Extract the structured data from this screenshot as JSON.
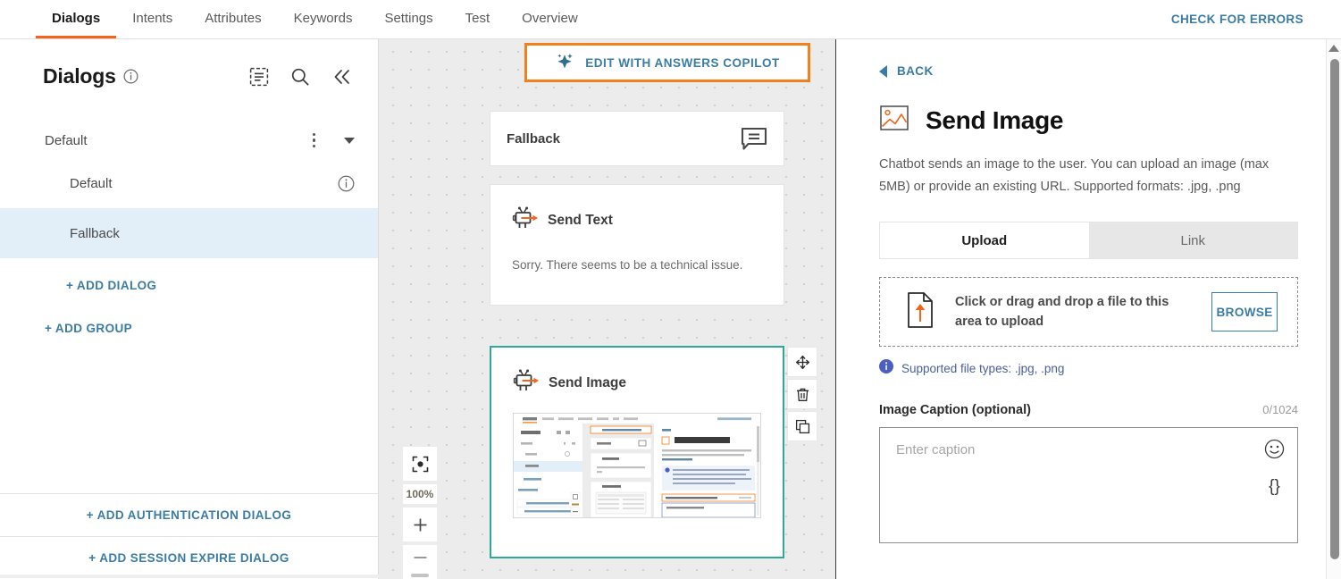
{
  "topbar": {
    "tabs": [
      {
        "label": "Dialogs",
        "active": true
      },
      {
        "label": "Intents",
        "active": false
      },
      {
        "label": "Attributes",
        "active": false
      },
      {
        "label": "Keywords",
        "active": false
      },
      {
        "label": "Settings",
        "active": false
      },
      {
        "label": "Test",
        "active": false
      },
      {
        "label": "Overview",
        "active": false
      }
    ],
    "check_errors": "CHECK FOR ERRORS"
  },
  "sidebar": {
    "title": "Dialogs",
    "group": {
      "name": "Default"
    },
    "items": [
      {
        "label": "Default",
        "selected": false,
        "has_info": true
      },
      {
        "label": "Fallback",
        "selected": true,
        "has_info": false
      }
    ],
    "add_dialog": "+ ADD DIALOG",
    "add_group": "+ ADD GROUP",
    "add_auth_dialog": "+ ADD AUTHENTICATION DIALOG",
    "add_session_expire_dialog": "+ ADD SESSION EXPIRE DIALOG"
  },
  "canvas": {
    "copilot_button": "EDIT WITH ANSWERS COPILOT",
    "fallback_card": {
      "title": "Fallback"
    },
    "send_text_card": {
      "title": "Send Text",
      "body": "Sorry. There seems to be a technical issue."
    },
    "send_image_card": {
      "title": "Send Image"
    },
    "zoom_level": "100%"
  },
  "panel": {
    "back": "BACK",
    "title": "Send Image",
    "description": "Chatbot sends an image to the user. You can upload an image (max 5MB) or provide an existing URL. Supported formats: .jpg, .png",
    "tabs": [
      {
        "label": "Upload",
        "active": true
      },
      {
        "label": "Link",
        "active": false
      }
    ],
    "dropzone_text": "Click or drag and drop a file to this area to upload",
    "browse_button": "BROWSE",
    "supported_types": "Supported file types: .jpg, .png",
    "caption_label": "Image Caption (optional)",
    "caption_counter": "0/1024",
    "caption_placeholder": "Enter caption",
    "caption_value": ""
  },
  "colors": {
    "accent_orange": "#f2801b",
    "link_blue": "#3a7ca5",
    "selected_teal": "#2ea89a",
    "selection_blue": "#e2eef8",
    "info_blue": "#4a5fc0"
  }
}
